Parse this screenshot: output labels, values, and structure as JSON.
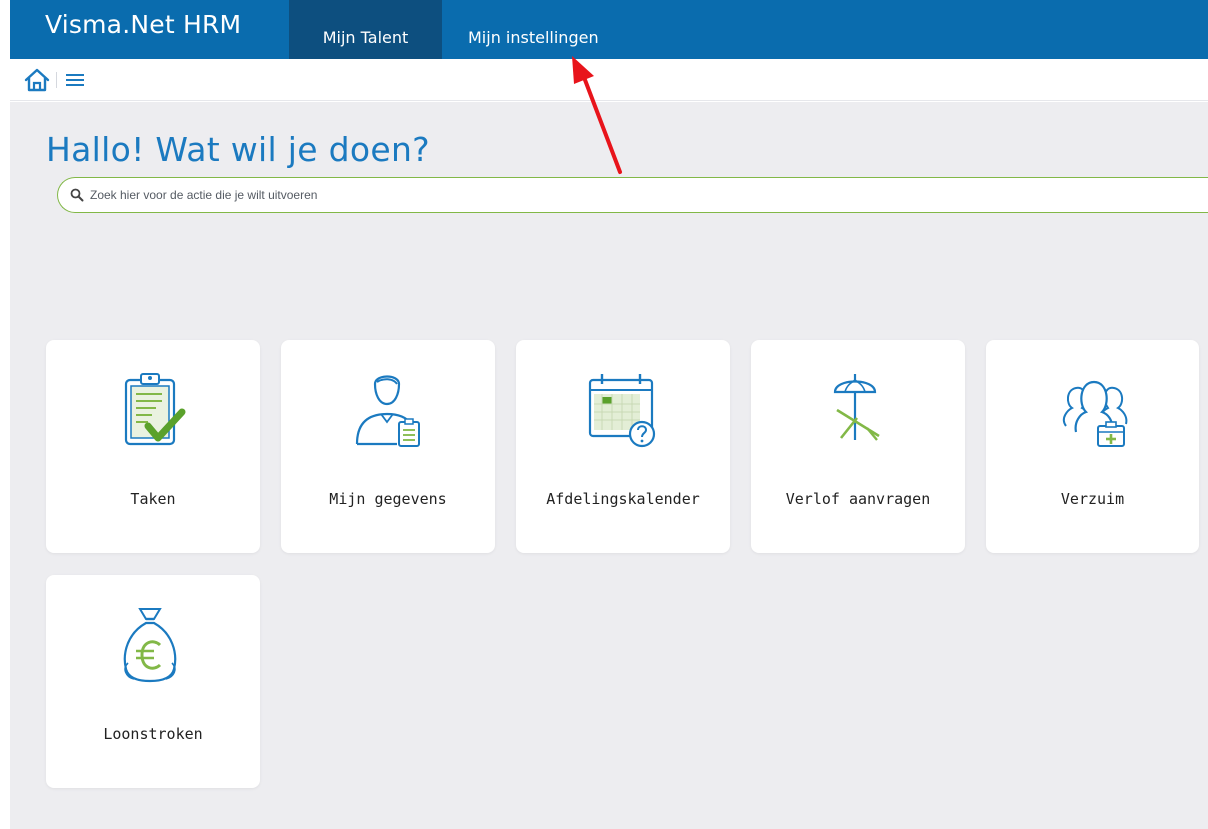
{
  "app": {
    "title": "Visma.Net HRM"
  },
  "topnav": {
    "tabs": [
      {
        "label": "Mijn Talent",
        "active": true
      },
      {
        "label": "Mijn instellingen",
        "active": false
      }
    ]
  },
  "toolbar": {
    "home_icon": "home-icon",
    "menu_icon": "hamburger-menu-icon"
  },
  "main": {
    "heading": "Hallo! Wat wil je doen?",
    "search": {
      "placeholder": "Zoek hier voor de actie die je wilt uitvoeren",
      "value": ""
    },
    "tiles": [
      {
        "label": "Taken",
        "icon": "clipboard-check-icon"
      },
      {
        "label": "Mijn gegevens",
        "icon": "person-document-icon"
      },
      {
        "label": "Afdelingskalender",
        "icon": "calendar-question-icon"
      },
      {
        "label": "Verlof aanvragen",
        "icon": "beach-chair-umbrella-icon"
      },
      {
        "label": "Verzuim",
        "icon": "people-first-aid-icon"
      },
      {
        "label": "Loonstroken",
        "icon": "euro-money-bag-icon"
      }
    ]
  },
  "colors": {
    "header_bg": "#0a6cae",
    "active_tab_bg": "#0d4f7f",
    "heading_blue": "#1b7ac0",
    "accent_green": "#82b847",
    "page_bg": "#ededf0",
    "annotation_arrow": "#e8141b"
  }
}
